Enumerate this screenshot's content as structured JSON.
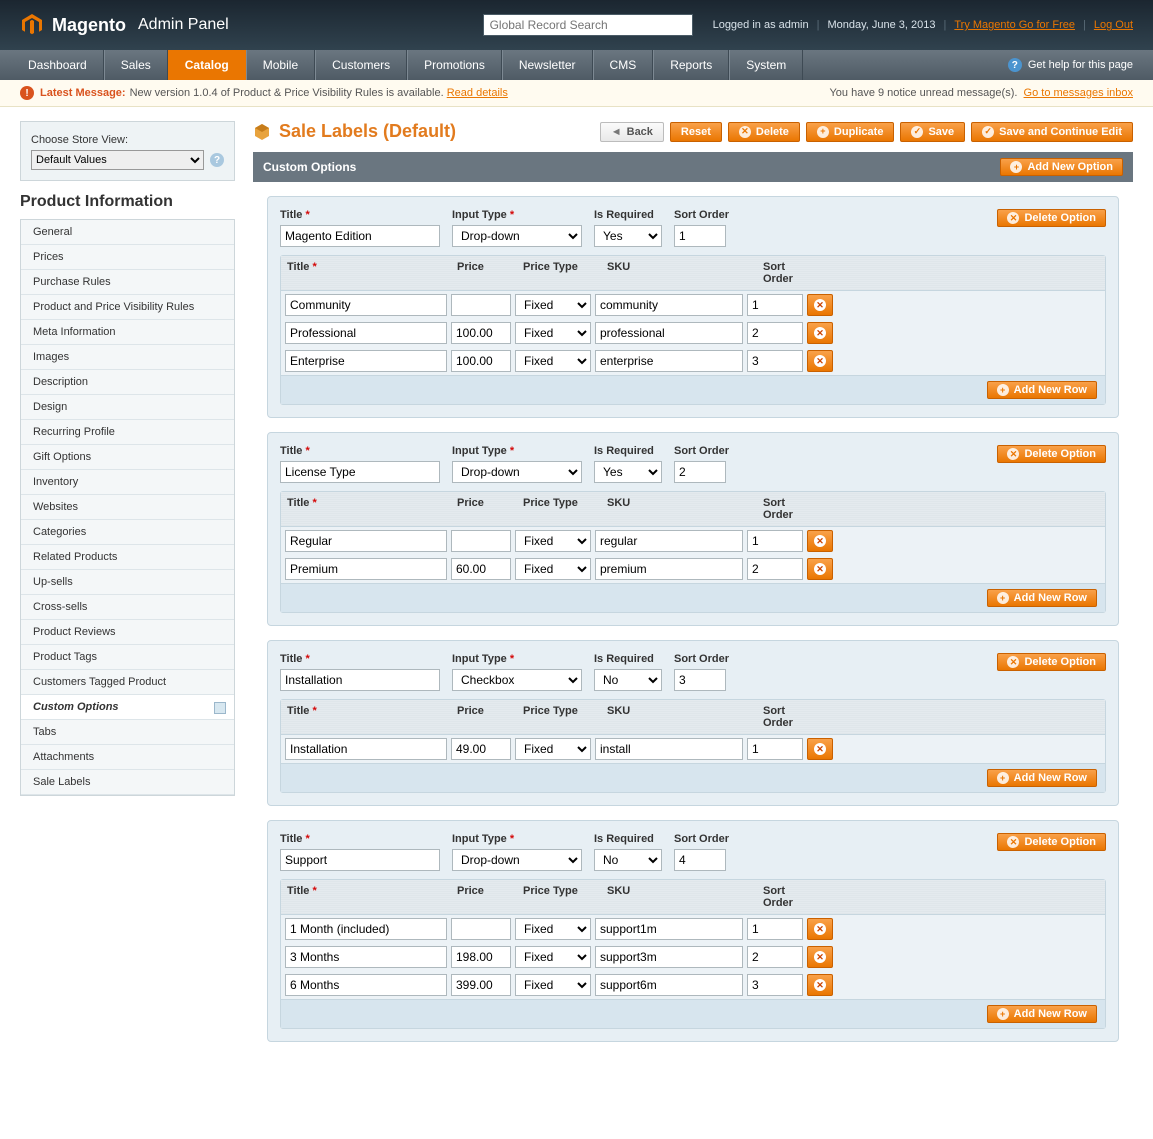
{
  "header": {
    "brand": "Magento",
    "brand_sub": "Admin Panel",
    "search_placeholder": "Global Record Search",
    "logged_in": "Logged in as admin",
    "date": "Monday, June 3, 2013",
    "try_link": "Try Magento Go for Free",
    "logout": "Log Out"
  },
  "nav": {
    "items": [
      "Dashboard",
      "Sales",
      "Catalog",
      "Mobile",
      "Customers",
      "Promotions",
      "Newsletter",
      "CMS",
      "Reports",
      "System"
    ],
    "active_index": 2,
    "help": "Get help for this page"
  },
  "message_bar": {
    "label": "Latest Message:",
    "text": "New version 1.0.4 of Product & Price Visibility Rules is available.",
    "details_link": "Read details",
    "right_text": "You have 9 notice unread message(s).",
    "right_link": "Go to messages inbox"
  },
  "store_view": {
    "label": "Choose Store View:",
    "selected": "Default Values"
  },
  "product_info": {
    "title": "Product Information",
    "tabs": [
      "General",
      "Prices",
      "Purchase Rules",
      "Product and Price Visibility Rules",
      "Meta Information",
      "Images",
      "Description",
      "Design",
      "Recurring Profile",
      "Gift Options",
      "Inventory",
      "Websites",
      "Categories",
      "Related Products",
      "Up-sells",
      "Cross-sells",
      "Product Reviews",
      "Product Tags",
      "Customers Tagged Product",
      "Custom Options",
      "Tabs",
      "Attachments",
      "Sale Labels"
    ],
    "active_index": 19
  },
  "page": {
    "title": "Sale Labels (Default)",
    "buttons": {
      "back": "Back",
      "reset": "Reset",
      "delete": "Delete",
      "duplicate": "Duplicate",
      "save": "Save",
      "save_continue": "Save and Continue Edit"
    }
  },
  "section": {
    "title": "Custom Options",
    "add_new_option": "Add New Option",
    "delete_option": "Delete Option",
    "add_new_row": "Add New Row",
    "headers": {
      "title": "Title",
      "input_type": "Input Type",
      "is_required": "Is Required",
      "sort_order": "Sort Order",
      "price": "Price",
      "price_type": "Price Type",
      "sku": "SKU"
    }
  },
  "options": [
    {
      "title": "Magento Edition",
      "input_type": "Drop-down",
      "is_required": "Yes",
      "sort_order": "1",
      "rows": [
        {
          "title": "Community",
          "price": "",
          "price_type": "Fixed",
          "sku": "community",
          "sort": "1"
        },
        {
          "title": "Professional",
          "price": "100.00",
          "price_type": "Fixed",
          "sku": "professional",
          "sort": "2"
        },
        {
          "title": "Enterprise",
          "price": "100.00",
          "price_type": "Fixed",
          "sku": "enterprise",
          "sort": "3"
        }
      ]
    },
    {
      "title": "License Type",
      "input_type": "Drop-down",
      "is_required": "Yes",
      "sort_order": "2",
      "rows": [
        {
          "title": "Regular",
          "price": "",
          "price_type": "Fixed",
          "sku": "regular",
          "sort": "1"
        },
        {
          "title": "Premium",
          "price": "60.00",
          "price_type": "Fixed",
          "sku": "premium",
          "sort": "2"
        }
      ]
    },
    {
      "title": "Installation",
      "input_type": "Checkbox",
      "is_required": "No",
      "sort_order": "3",
      "rows": [
        {
          "title": "Installation",
          "price": "49.00",
          "price_type": "Fixed",
          "sku": "install",
          "sort": "1"
        }
      ]
    },
    {
      "title": "Support",
      "input_type": "Drop-down",
      "is_required": "No",
      "sort_order": "4",
      "rows": [
        {
          "title": "1 Month (included)",
          "price": "",
          "price_type": "Fixed",
          "sku": "support1m",
          "sort": "1"
        },
        {
          "title": "3 Months",
          "price": "198.00",
          "price_type": "Fixed",
          "sku": "support3m",
          "sort": "2"
        },
        {
          "title": "6 Months",
          "price": "399.00",
          "price_type": "Fixed",
          "sku": "support6m",
          "sort": "3"
        }
      ]
    }
  ]
}
